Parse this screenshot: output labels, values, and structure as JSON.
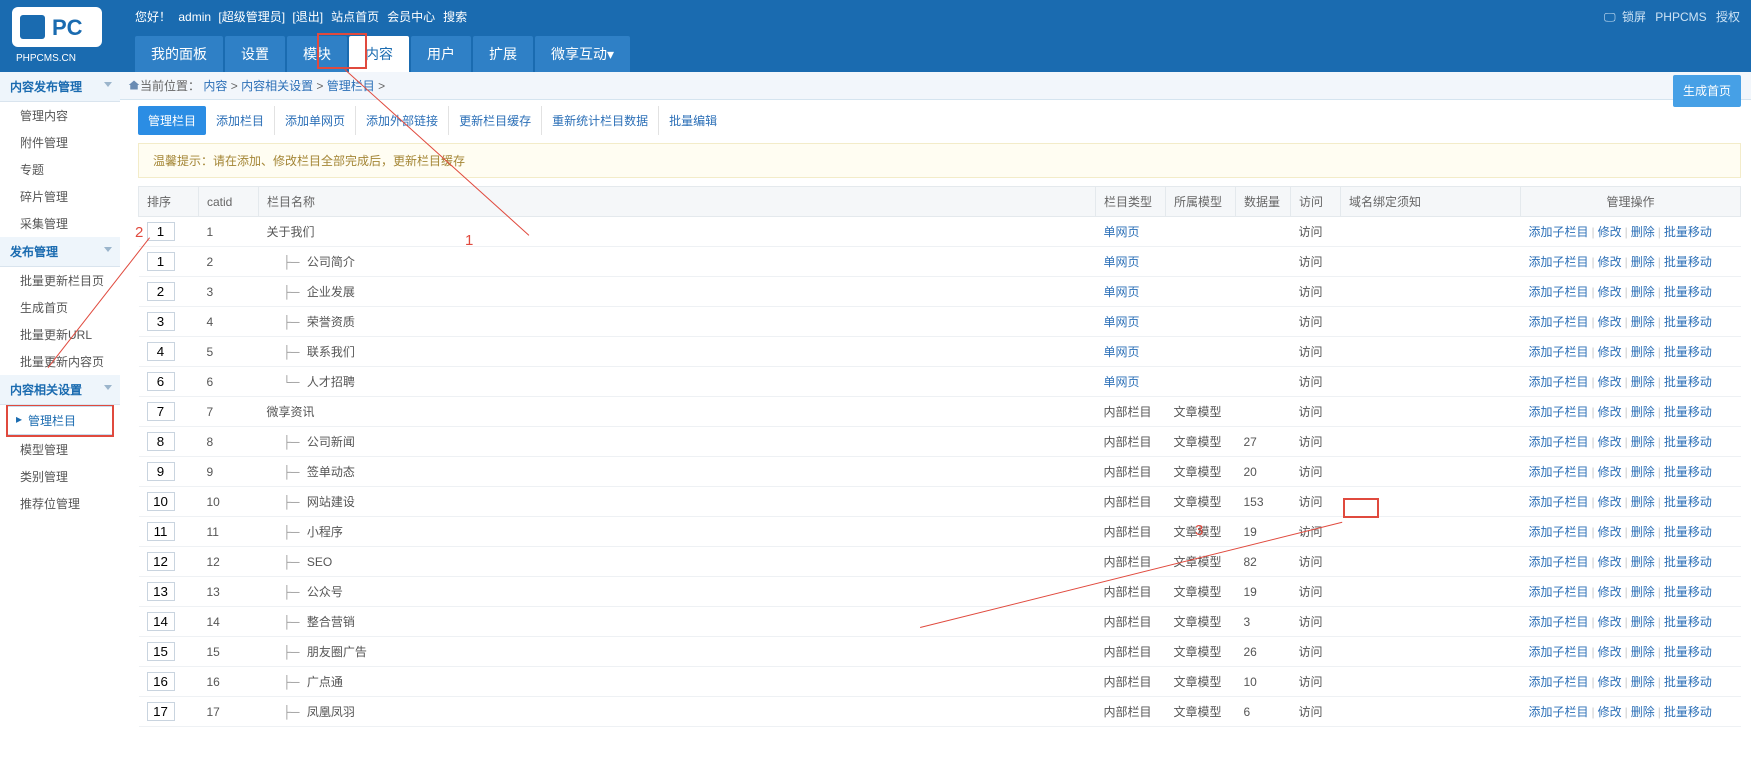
{
  "brand": "PHPCMS.CN",
  "greeting_prefix": "您好！",
  "user": "admin",
  "role": "[超级管理员]",
  "toplinks": [
    "[退出]",
    "站点首页",
    "会员中心",
    "搜索"
  ],
  "topright": {
    "lock": "锁屏",
    "name": "PHPCMS",
    "auth": "授权"
  },
  "navtabs": [
    "我的面板",
    "设置",
    "模块",
    "内容",
    "用户",
    "扩展",
    "微享互动▾"
  ],
  "navtab_active": 3,
  "crumb": {
    "prefix": "当前位置：",
    "parts": [
      "内容",
      "内容相关设置",
      "管理栏目"
    ]
  },
  "gen_home": "生成首页",
  "side": [
    {
      "title": "内容发布管理",
      "items": [
        "管理内容",
        "附件管理",
        "专题",
        "碎片管理",
        "采集管理"
      ]
    },
    {
      "title": "发布管理",
      "items": [
        "批量更新栏目页",
        "生成首页",
        "批量更新URL",
        "批量更新内容页"
      ]
    },
    {
      "title": "内容相关设置",
      "items": [
        "管理栏目",
        "模型管理",
        "类别管理",
        "推荐位管理"
      ],
      "active": 0
    }
  ],
  "subtabs": [
    "管理栏目",
    "添加栏目",
    "添加单网页",
    "添加外部链接",
    "更新栏目缓存",
    "重新统计栏目数据",
    "批量编辑"
  ],
  "subtab_active": 0,
  "tip": "温馨提示：请在添加、修改栏目全部完成后，更新栏目缓存",
  "th": {
    "sort": "排序",
    "catid": "catid",
    "name": "栏目名称",
    "type": "栏目类型",
    "model": "所属模型",
    "count": "数据量",
    "visit": "访问",
    "domain": "域名绑定须知",
    "ops": "管理操作"
  },
  "type": {
    "single": "单网页",
    "internal": "内部栏目"
  },
  "model": {
    "article": "文章模型"
  },
  "visit_label": "访问",
  "op": {
    "addsub": "添加子栏目",
    "edit": "修改",
    "del": "删除",
    "move": "批量移动"
  },
  "rows": [
    {
      "ord": "1",
      "id": "1",
      "name": "关于我们",
      "depth": 0,
      "last": false,
      "type": "single",
      "model": "",
      "count": ""
    },
    {
      "ord": "1",
      "id": "2",
      "name": "公司简介",
      "depth": 1,
      "last": false,
      "type": "single",
      "model": "",
      "count": ""
    },
    {
      "ord": "2",
      "id": "3",
      "name": "企业发展",
      "depth": 1,
      "last": false,
      "type": "single",
      "model": "",
      "count": ""
    },
    {
      "ord": "3",
      "id": "4",
      "name": "荣誉资质",
      "depth": 1,
      "last": false,
      "type": "single",
      "model": "",
      "count": ""
    },
    {
      "ord": "4",
      "id": "5",
      "name": "联系我们",
      "depth": 1,
      "last": false,
      "type": "single",
      "model": "",
      "count": ""
    },
    {
      "ord": "6",
      "id": "6",
      "name": "人才招聘",
      "depth": 1,
      "last": true,
      "type": "single",
      "model": "",
      "count": ""
    },
    {
      "ord": "7",
      "id": "7",
      "name": "微享资讯",
      "depth": 0,
      "last": false,
      "type": "internal",
      "model": "article",
      "count": ""
    },
    {
      "ord": "8",
      "id": "8",
      "name": "公司新闻",
      "depth": 1,
      "last": false,
      "type": "internal",
      "model": "article",
      "count": "27"
    },
    {
      "ord": "9",
      "id": "9",
      "name": "签单动态",
      "depth": 1,
      "last": false,
      "type": "internal",
      "model": "article",
      "count": "20"
    },
    {
      "ord": "10",
      "id": "10",
      "name": "网站建设",
      "depth": 1,
      "last": false,
      "type": "internal",
      "model": "article",
      "count": "153"
    },
    {
      "ord": "11",
      "id": "11",
      "name": "小程序",
      "depth": 1,
      "last": false,
      "type": "internal",
      "model": "article",
      "count": "19"
    },
    {
      "ord": "12",
      "id": "12",
      "name": "SEO",
      "depth": 1,
      "last": false,
      "type": "internal",
      "model": "article",
      "count": "82"
    },
    {
      "ord": "13",
      "id": "13",
      "name": "公众号",
      "depth": 1,
      "last": false,
      "type": "internal",
      "model": "article",
      "count": "19"
    },
    {
      "ord": "14",
      "id": "14",
      "name": "整合营销",
      "depth": 1,
      "last": false,
      "type": "internal",
      "model": "article",
      "count": "3"
    },
    {
      "ord": "15",
      "id": "15",
      "name": "朋友圈广告",
      "depth": 1,
      "last": false,
      "type": "internal",
      "model": "article",
      "count": "26"
    },
    {
      "ord": "16",
      "id": "16",
      "name": "广点通",
      "depth": 1,
      "last": false,
      "type": "internal",
      "model": "article",
      "count": "10"
    },
    {
      "ord": "17",
      "id": "17",
      "name": "凤凰凤羽",
      "depth": 1,
      "last": false,
      "type": "internal",
      "model": "article",
      "count": "6"
    }
  ],
  "annot": {
    "n1": "1",
    "n2": "2",
    "n3": "3"
  }
}
